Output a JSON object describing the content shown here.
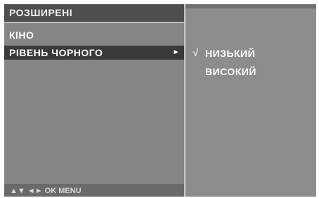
{
  "menu": {
    "title": "РОЗШИРЕНІ",
    "items": [
      {
        "label": "КІНО"
      },
      {
        "label": "РІВЕНЬ ЧОРНОГО",
        "arrow": "►"
      }
    ],
    "footer": "▲▼  ◄►  OK  MENU"
  },
  "submenu": {
    "check": "√",
    "options": [
      {
        "label": "НИЗЬКИЙ",
        "selected": true
      },
      {
        "label": "ВИСОКИЙ",
        "selected": false
      }
    ]
  }
}
